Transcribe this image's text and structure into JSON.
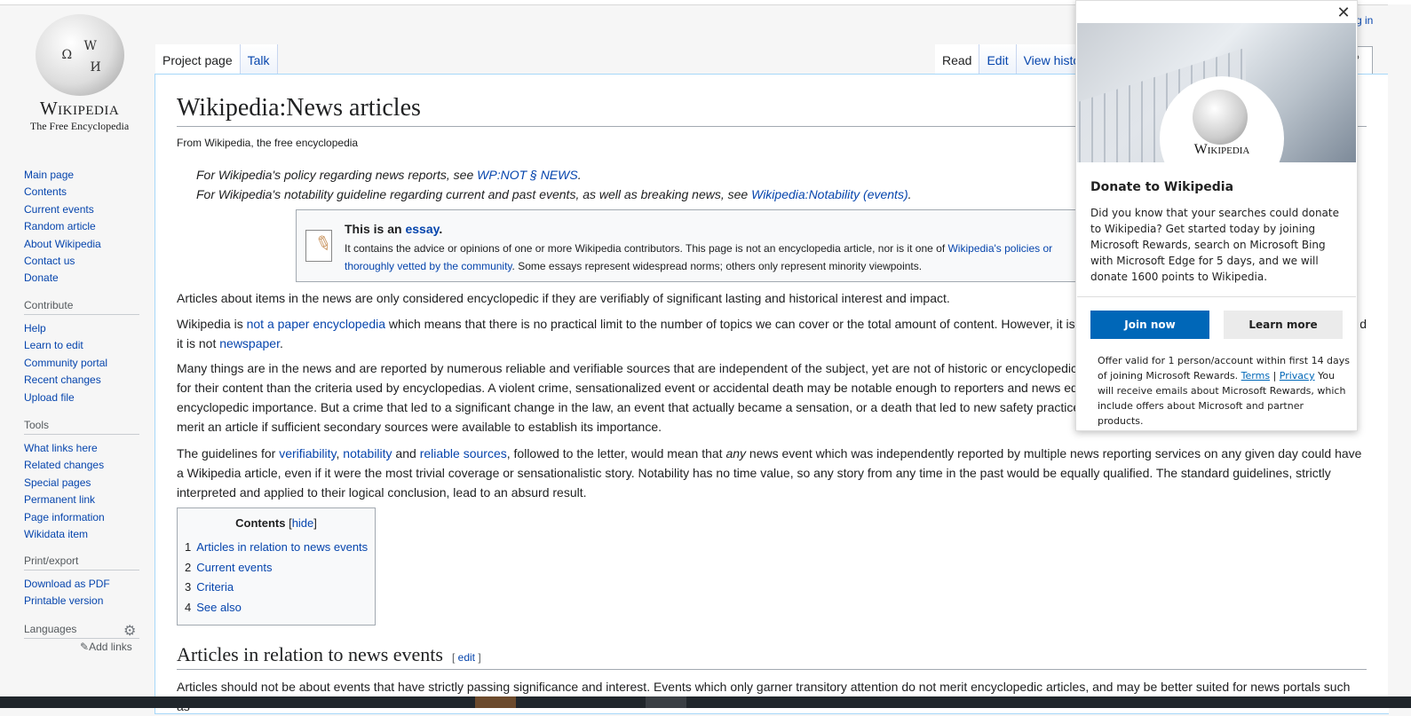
{
  "logo": {
    "wordmark": "Wikipedia",
    "tagline": "The Free Encyclopedia"
  },
  "nav": {
    "main": [
      "Main page",
      "Contents",
      "Current events",
      "Random article",
      "About Wikipedia",
      "Contact us",
      "Donate"
    ],
    "contribute": {
      "heading": "Contribute",
      "items": [
        "Help",
        "Learn to edit",
        "Community portal",
        "Recent changes",
        "Upload file"
      ]
    },
    "tools": {
      "heading": "Tools",
      "items": [
        "What links here",
        "Related changes",
        "Special pages",
        "Permanent link",
        "Page information",
        "Wikidata item"
      ]
    },
    "print": {
      "heading": "Print/export",
      "items": [
        "Download as PDF",
        "Printable version"
      ]
    },
    "languages": {
      "heading": "Languages",
      "add_links": "Add links"
    }
  },
  "tabs": {
    "left": [
      "Project page",
      "Talk"
    ],
    "right": [
      "Read",
      "Edit",
      "View history"
    ]
  },
  "login_fragment": "g in",
  "article": {
    "title": "Wikipedia:News articles",
    "from": "From Wikipedia, the free encyclopedia",
    "hatnote1_pre": "For Wikipedia's policy regarding news reports, see ",
    "hatnote1_link": "WP:NOT § NEWS",
    "hatnote1_post": ".",
    "hatnote2_pre": "For Wikipedia's notability guideline regarding current and past events, as well as breaking news, see ",
    "hatnote2_link": "Wikipedia:Notability (events)",
    "hatnote2_post": ".",
    "essay_title_pre": "This is an ",
    "essay_title_link": "essay",
    "essay_title_post": ".",
    "essay_text_pre": "It contains the advice or opinions of one or more Wikipedia contributors. This page is not an encyclopedia article, nor is it one of ",
    "essay_text_link1": "Wikipedia's policies or",
    "essay_text_link2": "thoroughly vetted by the community",
    "essay_text_post": ". Some essays represent widespread norms; others only represent minority viewpoints.",
    "p1": "Articles about items in the news are only considered encyclopedic if they are verifiably of significant lasting and historical interest and impact.",
    "p2_a": "Wikipedia is ",
    "p2_link1": "not a paper encyclopedia",
    "p2_b": " which means that there is no practical limit to the number of topics we can cover or the total amount of content. However, it is al",
    "p2_c": "d",
    "p2_d": "it is not ",
    "p2_link2": "newspaper",
    "p2_e": ".",
    "p3_l1": "Many things are in the news and are reported by numerous reliable and verifiable sources that are independent of the subject, yet are not of historic or encyclopedic in",
    "p3_l2": "for their content than the criteria used by encyclopedias. A violent crime, sensationalized event or accidental death may be notable enough to reporters and news edito",
    "p3_l3": "encyclopedic importance. But a crime that led to a significant change in the law, an event that actually became a sensation, or a death that led to new safety practices,",
    "p3_l4": "merit an article if sufficient secondary sources were available to establish its importance.",
    "p4_a": "The guidelines for ",
    "p4_link1": "verifiability",
    "p4_b": ", ",
    "p4_link2": "notability",
    "p4_c": " and ",
    "p4_link3": "reliable sources",
    "p4_d": ", followed to the letter, would mean that ",
    "p4_em": "any",
    "p4_e": " news event which was independently reported by multiple news reporting services on any given day could have a Wikipedia article, even if it were the most trivial coverage or sensationalistic story. Notability has no time value, so any story from any time in the past would be equally qualified. The standard guidelines, strictly interpreted and applied to their logical conclusion, lead to an absurd result.",
    "toc": {
      "title": "Contents",
      "hide": "hide",
      "items": [
        {
          "num": "1",
          "label": "Articles in relation to news events"
        },
        {
          "num": "2",
          "label": "Current events"
        },
        {
          "num": "3",
          "label": "Criteria"
        },
        {
          "num": "4",
          "label": "See also"
        }
      ]
    },
    "h2": "Articles in relation to news events",
    "h2_edit": "edit",
    "p5": "Articles should not be about events that have strictly passing significance and interest. Events which only garner transitory attention do not merit encyclopedic articles, and may be better suited for news portals such as"
  },
  "popup": {
    "hero_wordmark": "Wikipedia",
    "title": "Donate to Wikipedia",
    "text": "Did you know that your searches could donate to Wikipedia? Get started today by joining Microsoft Rewards, search on Microsoft Bing with Microsoft Edge for 5 days, and we will donate 1600 points to Wikipedia.",
    "join": "Join now",
    "learn": "Learn more",
    "fine_pre": "Offer valid for 1 person/account within first 14 days of joining Microsoft Rewards. ",
    "terms": "Terms",
    "sep": " | ",
    "privacy": "Privacy",
    "fine_post": " You will receive emails about Microsoft Rewards, which include offers about Microsoft and partner products."
  },
  "colors": {
    "link": "#0645ad",
    "button_primary": "#0067b8"
  }
}
